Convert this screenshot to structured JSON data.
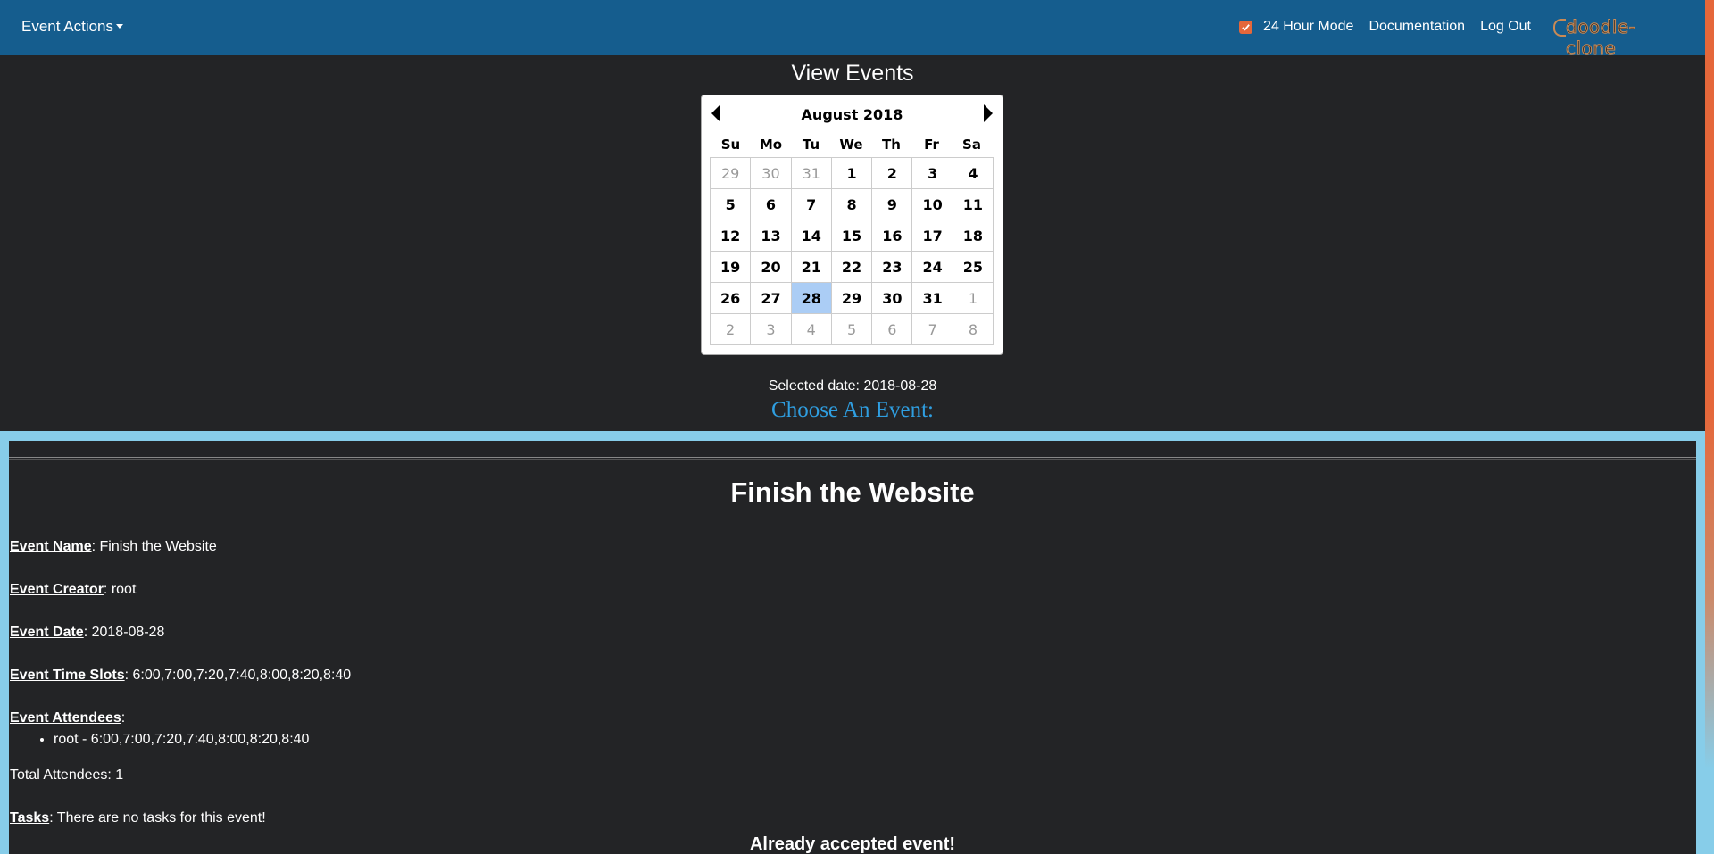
{
  "navbar": {
    "dropdown_label": "Event Actions",
    "mode_checkbox_checked": true,
    "mode_label": "24 Hour Mode",
    "documentation_label": "Documentation",
    "logout_label": "Log Out",
    "brand": "doodle-clone",
    "colors": {
      "bar": "#155d8e",
      "accent": "#e5673a"
    }
  },
  "page_title": "View Events",
  "calendar": {
    "month_label": "August 2018",
    "weekdays": [
      "Su",
      "Mo",
      "Tu",
      "We",
      "Th",
      "Fr",
      "Sa"
    ],
    "days": [
      {
        "d": "29",
        "other": true
      },
      {
        "d": "30",
        "other": true
      },
      {
        "d": "31",
        "other": true
      },
      {
        "d": "1"
      },
      {
        "d": "2"
      },
      {
        "d": "3"
      },
      {
        "d": "4"
      },
      {
        "d": "5"
      },
      {
        "d": "6"
      },
      {
        "d": "7"
      },
      {
        "d": "8"
      },
      {
        "d": "9"
      },
      {
        "d": "10"
      },
      {
        "d": "11"
      },
      {
        "d": "12"
      },
      {
        "d": "13"
      },
      {
        "d": "14"
      },
      {
        "d": "15"
      },
      {
        "d": "16"
      },
      {
        "d": "17"
      },
      {
        "d": "18"
      },
      {
        "d": "19"
      },
      {
        "d": "20"
      },
      {
        "d": "21"
      },
      {
        "d": "22"
      },
      {
        "d": "23"
      },
      {
        "d": "24"
      },
      {
        "d": "25"
      },
      {
        "d": "26"
      },
      {
        "d": "27"
      },
      {
        "d": "28",
        "selected": true
      },
      {
        "d": "29"
      },
      {
        "d": "30"
      },
      {
        "d": "31"
      },
      {
        "d": "1",
        "other": true
      },
      {
        "d": "2",
        "other": true
      },
      {
        "d": "3",
        "other": true
      },
      {
        "d": "4",
        "other": true
      },
      {
        "d": "5",
        "other": true
      },
      {
        "d": "6",
        "other": true
      },
      {
        "d": "7",
        "other": true
      },
      {
        "d": "8",
        "other": true
      }
    ]
  },
  "selected_date_text": "Selected date: 2018-08-28",
  "choose_event_text": "Choose An Event:",
  "event": {
    "title": "Finish the Website",
    "name_label": "Event Name",
    "name_value": ": Finish the Website",
    "creator_label": "Event Creator",
    "creator_value": ": root",
    "date_label": "Event Date",
    "date_value": ": 2018-08-28",
    "slots_label": "Event Time Slots",
    "slots_value": ": 6:00,7:00,7:20,7:40,8:00,8:20,8:40",
    "attendees_label": "Event Attendees",
    "attendees_value": ":",
    "attendees": [
      "root - 6:00,7:00,7:20,7:40,8:00,8:20,8:40"
    ],
    "total_attendees": "Total Attendees: 1",
    "tasks_label": "Tasks",
    "tasks_value": ": There are no tasks for this event!",
    "status_text": "Already accepted event!"
  }
}
